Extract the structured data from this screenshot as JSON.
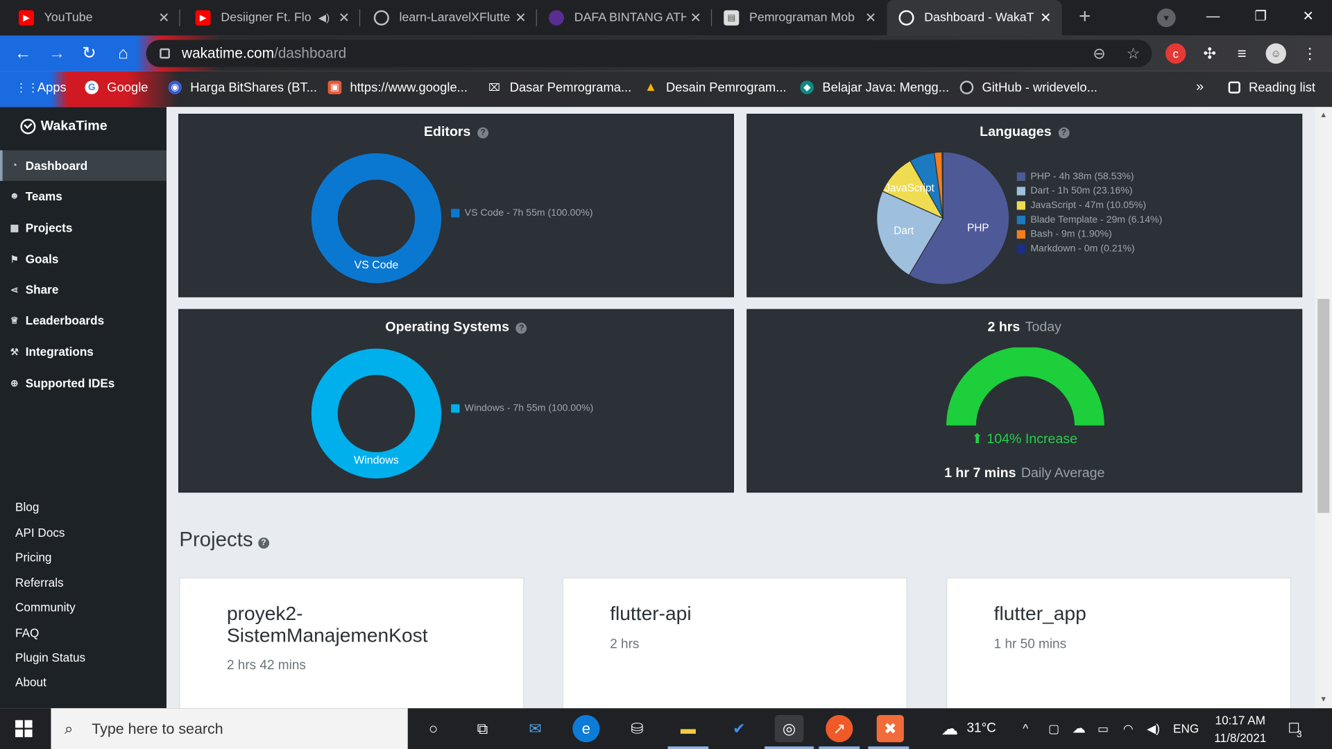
{
  "browser": {
    "tabs": [
      {
        "title": "YouTube",
        "icon": "youtube-icon",
        "color": "#ff0000"
      },
      {
        "title": "Desiigner Ft. Flo",
        "icon": "youtube-icon",
        "color": "#ff0000"
      },
      {
        "title": "learn-LaravelXFlutte",
        "icon": "github-icon",
        "color": "#202124"
      },
      {
        "title": "DAFA BINTANG ATH",
        "icon": "university-icon",
        "color": "#5a2d91"
      },
      {
        "title": "Pemrograman Mob",
        "icon": "document-icon",
        "color": "#dddddd"
      },
      {
        "title": "Dashboard - WakaT",
        "icon": "wakatime-icon",
        "color": "#ffffff"
      }
    ],
    "url_host": "wakatime.com",
    "url_path": "/dashboard",
    "bookmarks": [
      {
        "label": "Apps"
      },
      {
        "label": "Google"
      },
      {
        "label": "Harga BitShares (BT..."
      },
      {
        "label": "https://www.google..."
      },
      {
        "label": "Dasar Pemrograma..."
      },
      {
        "label": "Desain Pemrogram..."
      },
      {
        "label": "Belajar Java: Mengg..."
      },
      {
        "label": "GitHub - wridevelo..."
      }
    ],
    "bookmarks_more": "»",
    "reading_list": "Reading list"
  },
  "sidebar": {
    "brand": "WakaTime",
    "nav": [
      {
        "label": "Dashboard",
        "icon": "dashboard-icon",
        "active": true
      },
      {
        "label": "Teams",
        "icon": "users-icon"
      },
      {
        "label": "Projects",
        "icon": "grid-icon"
      },
      {
        "label": "Goals",
        "icon": "flag-icon"
      },
      {
        "label": "Share",
        "icon": "share-icon"
      },
      {
        "label": "Leaderboards",
        "icon": "trophy-icon"
      },
      {
        "label": "Integrations",
        "icon": "wrench-icon"
      },
      {
        "label": "Supported IDEs",
        "icon": "plus-circle-icon"
      }
    ],
    "footer": [
      "Blog",
      "API Docs",
      "Pricing",
      "Referrals",
      "Community",
      "FAQ",
      "Plugin Status",
      "About"
    ]
  },
  "panels": {
    "editors": {
      "title": "Editors",
      "legend": "VS Code - 7h 55m (100.00%)",
      "slice_label": "VS Code",
      "color": "#0a78d1"
    },
    "languages": {
      "title": "Languages",
      "legend": [
        {
          "label": "PHP - 4h 38m (58.53%)",
          "color": "#4e5a97"
        },
        {
          "label": "Dart - 1h 50m (23.16%)",
          "color": "#9ebfdd"
        },
        {
          "label": "JavaScript - 47m (10.05%)",
          "color": "#f0dc50"
        },
        {
          "label": "Blade Template - 29m (6.14%)",
          "color": "#1b7ac0"
        },
        {
          "label": "Bash - 9m (1.90%)",
          "color": "#f47d1f"
        },
        {
          "label": "Markdown - 0m (0.21%)",
          "color": "#1a2f8a"
        }
      ],
      "slice_labels": {
        "php": "PHP",
        "dart": "Dart",
        "js": "JavaScript"
      }
    },
    "os": {
      "title": "Operating Systems",
      "legend": "Windows - 7h 55m (100.00%)",
      "slice_label": "Windows",
      "color": "#00b0ec"
    },
    "today": {
      "hours": "2 hrs",
      "label": "Today",
      "increase": "104% Increase",
      "daily_value": "1 hr 7 mins",
      "daily_label": "Daily Average",
      "gauge_color": "#1ccf3b"
    }
  },
  "projects": {
    "title": "Projects",
    "items": [
      {
        "name": "proyek2-SistemManajemenKost",
        "name_line1": "proyek2-",
        "name_line2": "SistemManajemenKost",
        "time": "2 hrs 42 mins"
      },
      {
        "name": "flutter-api",
        "time": "2 hrs"
      },
      {
        "name": "flutter_app",
        "time": "1 hr 50 mins"
      }
    ]
  },
  "taskbar": {
    "search_placeholder": "Type here to search",
    "weather": "31°C",
    "language": "ENG",
    "time": "10:17 AM",
    "date": "11/8/2021",
    "notifications": "3"
  },
  "chart_data": [
    {
      "type": "pie",
      "title": "Editors",
      "categories": [
        "VS Code"
      ],
      "values": [
        100.0
      ],
      "labels": [
        "VS Code - 7h 55m (100.00%)"
      ],
      "style": "donut"
    },
    {
      "type": "pie",
      "title": "Languages",
      "categories": [
        "PHP",
        "Dart",
        "JavaScript",
        "Blade Template",
        "Bash",
        "Markdown"
      ],
      "values": [
        58.53,
        23.16,
        10.05,
        6.14,
        1.9,
        0.21
      ],
      "labels": [
        "PHP - 4h 38m (58.53%)",
        "Dart - 1h 50m (23.16%)",
        "JavaScript - 47m (10.05%)",
        "Blade Template - 29m (6.14%)",
        "Bash - 9m (1.90%)",
        "Markdown - 0m (0.21%)"
      ],
      "legend": "right"
    },
    {
      "type": "pie",
      "title": "Operating Systems",
      "categories": [
        "Windows"
      ],
      "values": [
        100.0
      ],
      "labels": [
        "Windows - 7h 55m (100.00%)"
      ],
      "style": "donut"
    }
  ]
}
